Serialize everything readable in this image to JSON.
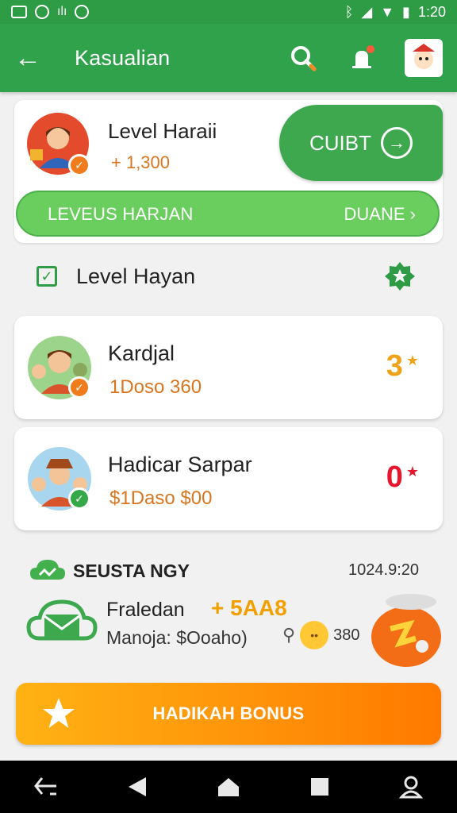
{
  "status_bar": {
    "time": "1:20"
  },
  "header": {
    "title": "Kasualian"
  },
  "top_card": {
    "name": "Level Haraii",
    "score": "+ 1,300",
    "action_label": "CUIBT",
    "progress_label": "LEVEUS HARJAN",
    "progress_right": "DUANE",
    "progress_fraction": 1.0
  },
  "section": {
    "label": "Level Hayan"
  },
  "list": [
    {
      "name": "Kardjal",
      "value": "1Doso 360",
      "rank": "3",
      "rank_star": "★",
      "rank_color": "#f0a21a",
      "badge_color": "#f07c1c"
    },
    {
      "name": "Hadicar Sarpar",
      "value": "$1Daso $00",
      "rank": "0",
      "rank_star": "★",
      "rank_color": "#e6162e",
      "badge_color": "#35a848"
    }
  ],
  "notification": {
    "title": "SEUSTA NGY",
    "time": "1024.9:20",
    "sender": "Fraledan",
    "bonus": "+ 5AA8",
    "subtitle": "Manoja: $Ooaho)",
    "count": "380"
  },
  "bonus_button": {
    "label": "HADIKAH BONUS"
  },
  "colors": {
    "primary": "#31a24c",
    "accent": "#ff8c00",
    "value_orange": "#d8761f"
  }
}
